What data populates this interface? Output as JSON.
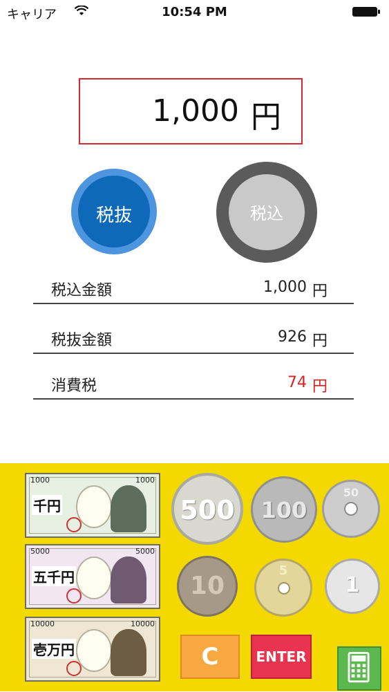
{
  "status_bar": {
    "carrier": "キャリア",
    "time": "10:54 PM"
  },
  "amount": {
    "value": "1,000",
    "unit": "円"
  },
  "mode": {
    "exclusive_label": "税抜",
    "inclusive_label": "税込",
    "selected": "税抜"
  },
  "results": [
    {
      "label": "税込金額",
      "value": "1,000",
      "unit": "円"
    },
    {
      "label": "税抜金額",
      "value": "926",
      "unit": "円"
    },
    {
      "label": "消費税",
      "value": "74",
      "unit": "円"
    }
  ],
  "notes": [
    {
      "number": "1000",
      "kanji": "千円"
    },
    {
      "number": "5000",
      "kanji": "五千円"
    },
    {
      "number": "10000",
      "kanji": "壱万円"
    }
  ],
  "coins": [
    "500",
    "100",
    "50",
    "10",
    "5",
    "1"
  ],
  "buttons": {
    "clear": "C",
    "enter": "ENTER"
  },
  "colors": {
    "pad_bg": "#f4d901",
    "amount_border": "#d7262f",
    "tax_red": "#d92020",
    "clear_btn": "#f7a840",
    "enter_btn": "#e8344f",
    "calc_btn": "#5cb84e"
  }
}
